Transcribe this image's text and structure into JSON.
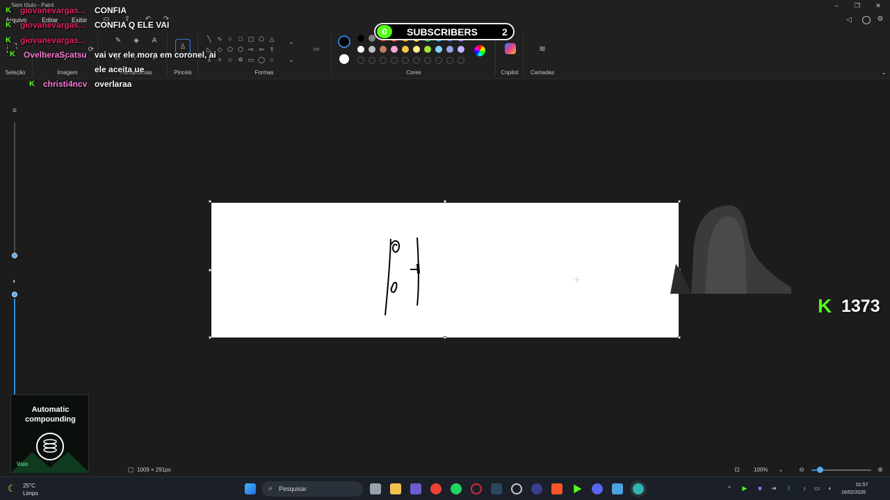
{
  "window": {
    "title": "Sem título - Paint"
  },
  "menu": {
    "items": [
      "Arquivo",
      "Editar",
      "Exibir"
    ]
  },
  "ribbon": {
    "groups": [
      "Seleção",
      "Imagem",
      "Ferramentas",
      "Pincéis",
      "Formas",
      "Cores",
      "Copilot",
      "Camadas"
    ]
  },
  "colors": {
    "row1": [
      "#000000",
      "#808080",
      "#b91c1c",
      "#ef4444",
      "#f59e0b",
      "#fde047",
      "#22c55e",
      "#06b6d4",
      "#3b5bdb",
      "#8b5cf6"
    ],
    "row2": [
      "#ffffff",
      "#c0c0c0",
      "#c08060",
      "#f9a8d4",
      "#f5c542",
      "#fef08a",
      "#a3e635",
      "#7dd3fc",
      "#93a4e8",
      "#c4b5fd"
    ],
    "primary": "#000000",
    "secondary": "#ffffff"
  },
  "status": {
    "canvas_size": "1009 × 291px",
    "zoom": "100%"
  },
  "taskbar": {
    "search_placeholder": "Pesquisar",
    "weather_temp": "25°C",
    "weather_desc": "Limpo",
    "time": "01:57",
    "date": "16/02/2026"
  },
  "overlay": {
    "chat": [
      {
        "user": "giovanevargas...",
        "message": "CONFIA",
        "user_color": "#e0245e"
      },
      {
        "user": "giovanevargas...",
        "message": "CONFIA Q ELE VAI",
        "user_color": "#e0245e"
      },
      {
        "user": "giovanevargas...",
        "message": "",
        "user_color": "#e0245e"
      },
      {
        "user": "OvelheraScatsu",
        "message": "vai ver ele mora em coronel, ai",
        "message2": "ele aceita ue",
        "user_color": "#ff7ad9"
      },
      {
        "user": "christi4ncv",
        "message": "overlaraa",
        "user_color": "#ff7ad9"
      }
    ],
    "subscribers": {
      "left_count": "0",
      "label": "SUBSCRIBERS",
      "right_count": "2"
    },
    "viewers": "1373",
    "ad": {
      "headline": "Automatic compounding",
      "footer": "Valo"
    }
  }
}
